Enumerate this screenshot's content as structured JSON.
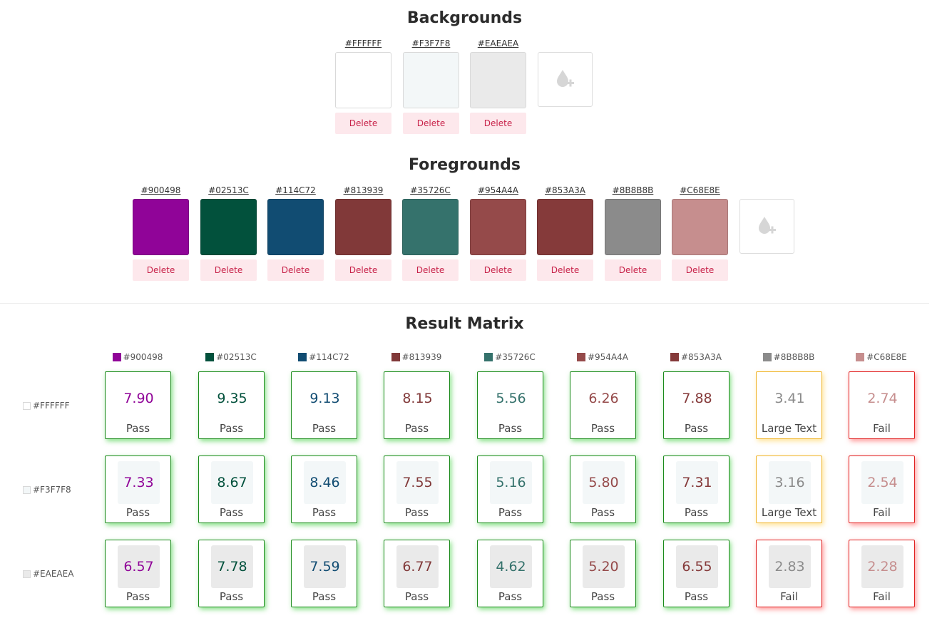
{
  "backgrounds": {
    "title": "Backgrounds",
    "delete_label": "Delete",
    "items": [
      {
        "hex": "#FFFFFF"
      },
      {
        "hex": "#F3F7F8"
      },
      {
        "hex": "#EAEAEA"
      }
    ]
  },
  "foregrounds": {
    "title": "Foregrounds",
    "delete_label": "Delete",
    "items": [
      {
        "hex": "#900498"
      },
      {
        "hex": "#02513C"
      },
      {
        "hex": "#114C72"
      },
      {
        "hex": "#813939"
      },
      {
        "hex": "#35726C"
      },
      {
        "hex": "#954A4A"
      },
      {
        "hex": "#853A3A"
      },
      {
        "hex": "#8B8B8B"
      },
      {
        "hex": "#C68E8E"
      }
    ]
  },
  "matrix": {
    "title": "Result Matrix",
    "rows": [
      {
        "bg": "#FFFFFF",
        "cells": [
          {
            "ratio": "7.90",
            "status": "Pass"
          },
          {
            "ratio": "9.35",
            "status": "Pass"
          },
          {
            "ratio": "9.13",
            "status": "Pass"
          },
          {
            "ratio": "8.15",
            "status": "Pass"
          },
          {
            "ratio": "5.56",
            "status": "Pass"
          },
          {
            "ratio": "6.26",
            "status": "Pass"
          },
          {
            "ratio": "7.88",
            "status": "Pass"
          },
          {
            "ratio": "3.41",
            "status": "Large Text"
          },
          {
            "ratio": "2.74",
            "status": "Fail"
          }
        ]
      },
      {
        "bg": "#F3F7F8",
        "cells": [
          {
            "ratio": "7.33",
            "status": "Pass"
          },
          {
            "ratio": "8.67",
            "status": "Pass"
          },
          {
            "ratio": "8.46",
            "status": "Pass"
          },
          {
            "ratio": "7.55",
            "status": "Pass"
          },
          {
            "ratio": "5.16",
            "status": "Pass"
          },
          {
            "ratio": "5.80",
            "status": "Pass"
          },
          {
            "ratio": "7.31",
            "status": "Pass"
          },
          {
            "ratio": "3.16",
            "status": "Large Text"
          },
          {
            "ratio": "2.54",
            "status": "Fail"
          }
        ]
      },
      {
        "bg": "#EAEAEA",
        "cells": [
          {
            "ratio": "6.57",
            "status": "Pass"
          },
          {
            "ratio": "7.78",
            "status": "Pass"
          },
          {
            "ratio": "7.59",
            "status": "Pass"
          },
          {
            "ratio": "6.77",
            "status": "Pass"
          },
          {
            "ratio": "4.62",
            "status": "Pass"
          },
          {
            "ratio": "5.20",
            "status": "Pass"
          },
          {
            "ratio": "6.55",
            "status": "Pass"
          },
          {
            "ratio": "2.83",
            "status": "Fail"
          },
          {
            "ratio": "2.28",
            "status": "Fail"
          }
        ]
      }
    ]
  },
  "icons": {
    "add_color": "add-color-drop-icon"
  }
}
